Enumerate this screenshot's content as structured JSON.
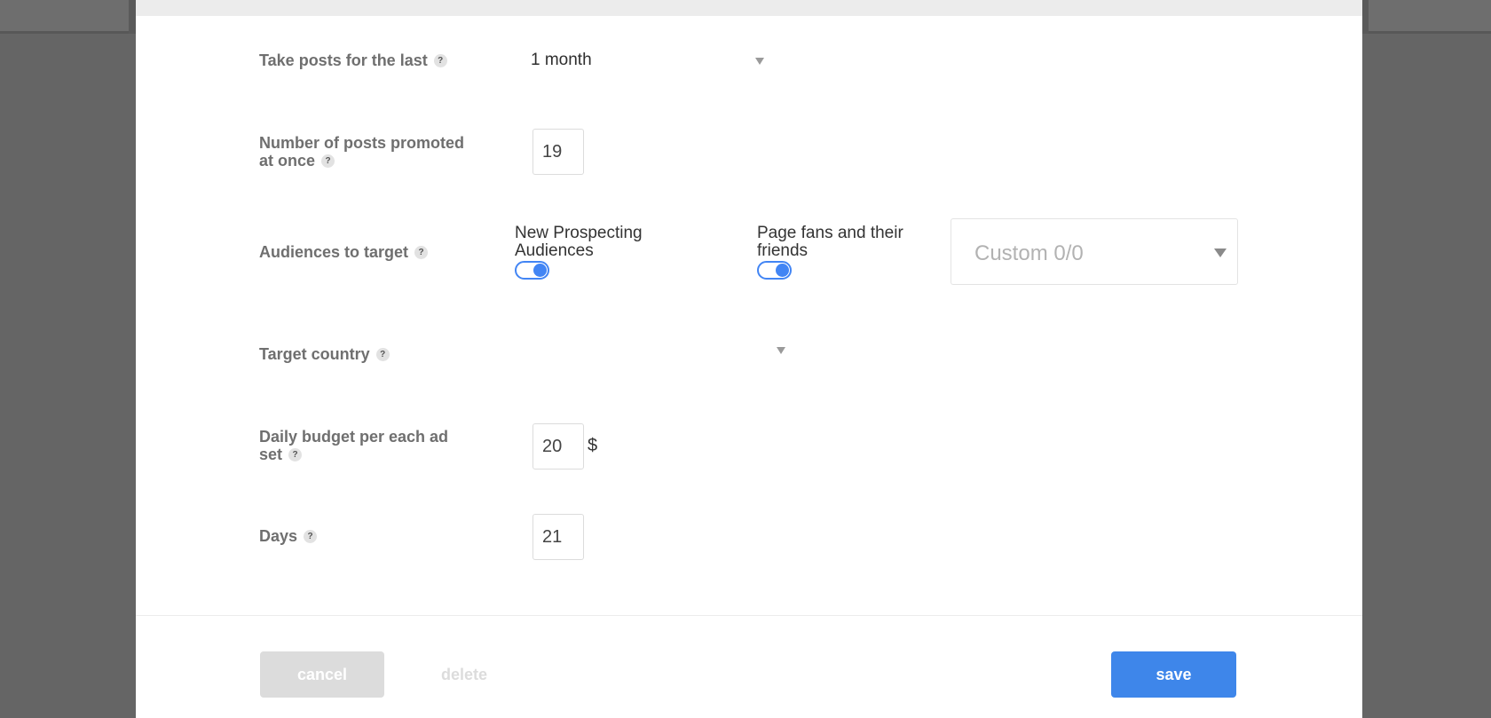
{
  "form": {
    "take_posts": {
      "label": "Take posts for the last",
      "help": "?",
      "value": "1 month"
    },
    "posts_promoted": {
      "label_line1": "Number of posts promoted",
      "label_line2": "at once",
      "help": "?",
      "value": "19"
    },
    "audiences": {
      "label": "Audiences to target",
      "help": "?",
      "prospecting_label_line1": "New Prospecting",
      "prospecting_label_line2": "Audiences",
      "prospecting_enabled": true,
      "fans_label_line1": "Page fans and their",
      "fans_label_line2": "friends",
      "fans_enabled": true,
      "custom_value": "Custom 0/0"
    },
    "target_country": {
      "label": "Target country",
      "help": "?",
      "value": ""
    },
    "daily_budget": {
      "label_line1": "Daily budget per each ad",
      "label_line2": "set",
      "help": "?",
      "value": "20",
      "currency": "$"
    },
    "days": {
      "label": "Days",
      "help": "?",
      "value": "21"
    }
  },
  "footer": {
    "cancel_label": "cancel",
    "delete_label": "delete",
    "save_label": "save"
  },
  "colors": {
    "accent": "#3e86ea",
    "toggle": "#4285f4",
    "backdrop": "#656565"
  },
  "icons": [
    "help-icon",
    "chevron-down-icon"
  ]
}
